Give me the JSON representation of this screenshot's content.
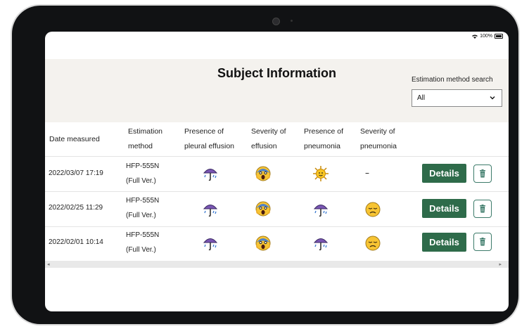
{
  "status": {
    "battery_pct": "100%"
  },
  "header": {
    "title": "Subject Information",
    "search_label": "Estimation method search",
    "select_value": "All"
  },
  "table": {
    "columns": [
      [
        "Date measured"
      ],
      [
        "Estimation",
        "method"
      ],
      [
        "Presence of",
        "pleural effusion"
      ],
      [
        "Severity of",
        "effusion"
      ],
      [
        "Presence of",
        "pneumonia"
      ],
      [
        "Severity of",
        "pneumonia"
      ]
    ],
    "rows": [
      {
        "date": "2022/03/07 17:19",
        "method_line1": "HFP-555N",
        "method_line2": "(Full Ver.)",
        "effusion_presence_icon": "umbrella-rain-icon",
        "effusion_severity_icon": "screaming-face-icon",
        "pneumonia_presence_icon": "sun-icon",
        "pneumonia_severity": "–",
        "details_label": "Details"
      },
      {
        "date": "2022/02/25 11:29",
        "method_line1": "HFP-555N",
        "method_line2": "(Full Ver.)",
        "effusion_presence_icon": "umbrella-rain-icon",
        "effusion_severity_icon": "screaming-face-icon",
        "pneumonia_presence_icon": "umbrella-rain-icon",
        "pneumonia_severity_icon": "disappointed-face-icon",
        "details_label": "Details"
      },
      {
        "date": "2022/02/01 10:14",
        "method_line1": "HFP-555N",
        "method_line2": "(Full Ver.)",
        "effusion_presence_icon": "umbrella-rain-icon",
        "effusion_severity_icon": "screaming-face-icon",
        "pneumonia_presence_icon": "umbrella-rain-icon",
        "pneumonia_severity_icon": "disappointed-face-icon",
        "details_label": "Details"
      }
    ]
  },
  "colors": {
    "details_button": "#2e6b4a",
    "trash_border": "#3d7b6a",
    "header_bg": "#f4f2ee"
  }
}
